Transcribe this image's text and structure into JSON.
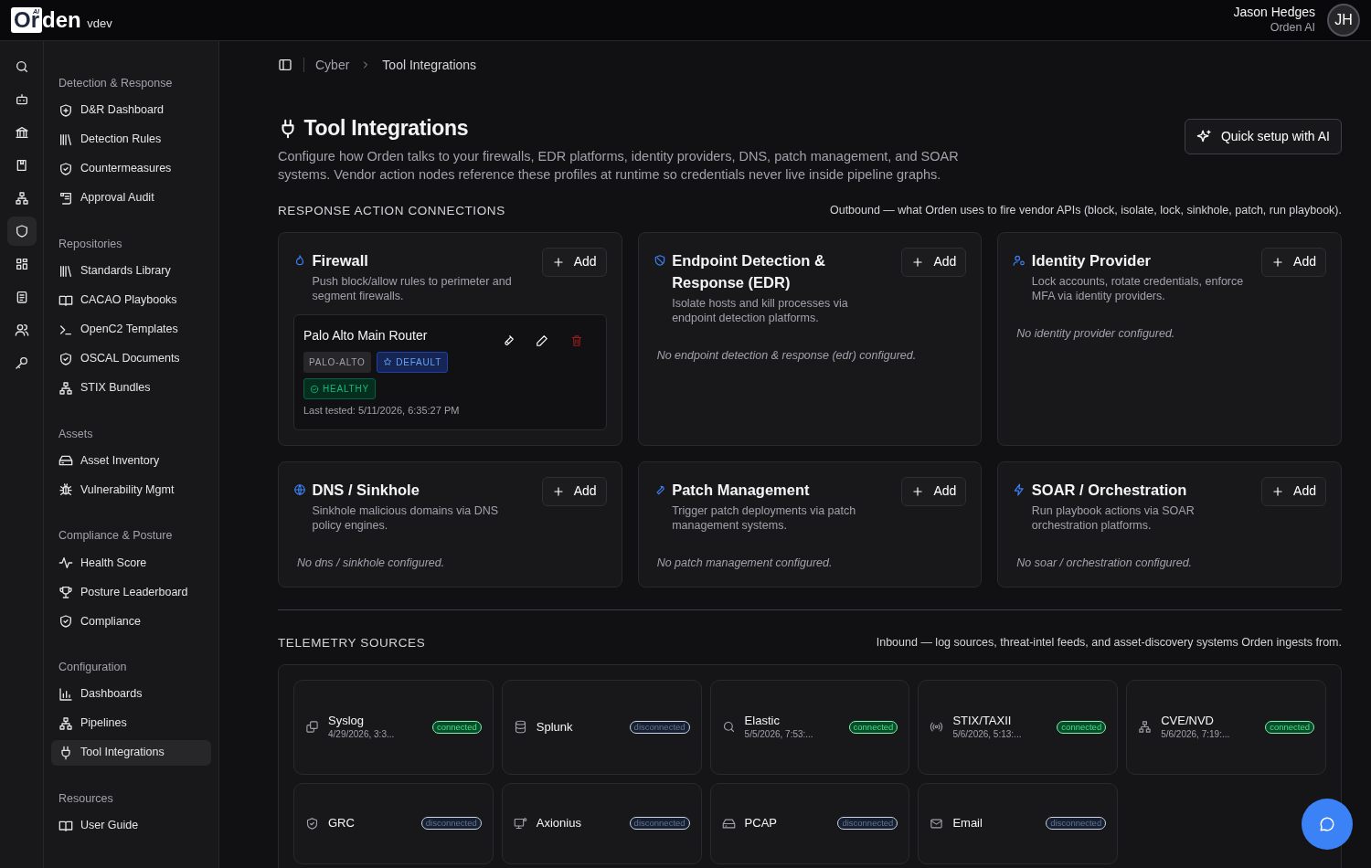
{
  "header": {
    "logo_boxed": "Or",
    "logo_rest": "den",
    "logo_mark": "AI",
    "env": "vdev",
    "user_name": "Jason Hedges",
    "user_org": "Orden AI",
    "avatar": "JH"
  },
  "rail": [
    {
      "selected": false
    },
    {
      "selected": false
    },
    {
      "selected": false
    },
    {
      "selected": false
    },
    {
      "selected": false
    },
    {
      "selected": true
    },
    {
      "selected": false
    },
    {
      "selected": false
    },
    {
      "selected": false
    },
    {
      "selected": false
    }
  ],
  "sidebar": [
    {
      "title": "Detection & Response",
      "items": [
        {
          "label": "D&R Dashboard",
          "selected": false
        },
        {
          "label": "Detection Rules",
          "selected": false
        },
        {
          "label": "Countermeasures",
          "selected": false
        },
        {
          "label": "Approval Audit",
          "selected": false
        }
      ]
    },
    {
      "title": "Repositories",
      "items": [
        {
          "label": "Standards Library",
          "selected": false
        },
        {
          "label": "CACAO Playbooks",
          "selected": false
        },
        {
          "label": "OpenC2 Templates",
          "selected": false
        },
        {
          "label": "OSCAL Documents",
          "selected": false
        },
        {
          "label": "STIX Bundles",
          "selected": false
        }
      ]
    },
    {
      "title": "Assets",
      "items": [
        {
          "label": "Asset Inventory",
          "selected": false
        },
        {
          "label": "Vulnerability Mgmt",
          "selected": false
        }
      ]
    },
    {
      "title": "Compliance & Posture",
      "items": [
        {
          "label": "Health Score",
          "selected": false
        },
        {
          "label": "Posture Leaderboard",
          "selected": false
        },
        {
          "label": "Compliance",
          "selected": false
        }
      ]
    },
    {
      "title": "Configuration",
      "items": [
        {
          "label": "Dashboards",
          "selected": false
        },
        {
          "label": "Pipelines",
          "selected": false
        },
        {
          "label": "Tool Integrations",
          "selected": true
        }
      ]
    },
    {
      "title": "Resources",
      "items": [
        {
          "label": "User Guide",
          "selected": false
        }
      ]
    }
  ],
  "breadcrumb": [
    "Cyber",
    "Tool Integrations"
  ],
  "page": {
    "title": "Tool Integrations",
    "description": "Configure how Orden talks to your firewalls, EDR platforms, identity providers, DNS, patch management, and SOAR systems. Vendor action nodes reference these profiles at runtime so credentials never live inside pipeline graphs.",
    "ai_button": "Quick setup with AI"
  },
  "response_section": {
    "title": "RESPONSE ACTION CONNECTIONS",
    "note": "Outbound — what Orden uses to fire vendor APIs (block, isolate, lock, sinkhole, patch, run playbook).",
    "cards": [
      {
        "title": "Firewall",
        "description": "Push block/allow rules to perimeter and segment firewalls.",
        "add": "Add",
        "profiles": [
          {
            "name": "Palo Alto Main Router",
            "vendor": "PALO-ALTO",
            "default": "DEFAULT",
            "health": "HEALTHY",
            "healthy": true,
            "tested": "Last tested: 5/11/2026, 6:35:27 PM"
          }
        ]
      },
      {
        "title": "Endpoint Detection & Response (EDR)",
        "description": "Isolate hosts and kill processes via endpoint detection platforms.",
        "add": "Add",
        "empty": "No endpoint detection & response (edr) configured."
      },
      {
        "title": "Identity Provider",
        "description": "Lock accounts, rotate credentials, enforce MFA via identity providers.",
        "add": "Add",
        "empty": "No identity provider configured."
      },
      {
        "title": "DNS / Sinkhole",
        "description": "Sinkhole malicious domains via DNS policy engines.",
        "add": "Add",
        "empty": "No dns / sinkhole configured."
      },
      {
        "title": "Patch Management",
        "description": "Trigger patch deployments via patch management systems.",
        "add": "Add",
        "empty": "No patch management configured."
      },
      {
        "title": "SOAR / Orchestration",
        "description": "Run playbook actions via SOAR orchestration platforms.",
        "add": "Add",
        "empty": "No soar / orchestration configured."
      }
    ]
  },
  "telemetry_section": {
    "title": "TELEMETRY SOURCES",
    "note": "Inbound — log sources, threat-intel feeds, and asset-discovery systems Orden ingests from.",
    "sources": [
      {
        "name": "Syslog",
        "time": "4/29/2026, 3:3...",
        "status": "connected",
        "connected": true
      },
      {
        "name": "Splunk",
        "status": "disconnected",
        "connected": false
      },
      {
        "name": "Elastic",
        "time": "5/5/2026, 7:53:...",
        "status": "connected",
        "connected": true
      },
      {
        "name": "STIX/TAXII",
        "time": "5/6/2026, 5:13:...",
        "status": "connected",
        "connected": true
      },
      {
        "name": "CVE/NVD",
        "time": "5/6/2026, 7:19:...",
        "status": "connected",
        "connected": true
      },
      {
        "name": "GRC",
        "status": "disconnected",
        "connected": false
      },
      {
        "name": "Axionius",
        "status": "disconnected",
        "connected": false
      },
      {
        "name": "PCAP",
        "status": "disconnected",
        "connected": false
      },
      {
        "name": "Email",
        "status": "disconnected",
        "connected": false
      }
    ]
  }
}
